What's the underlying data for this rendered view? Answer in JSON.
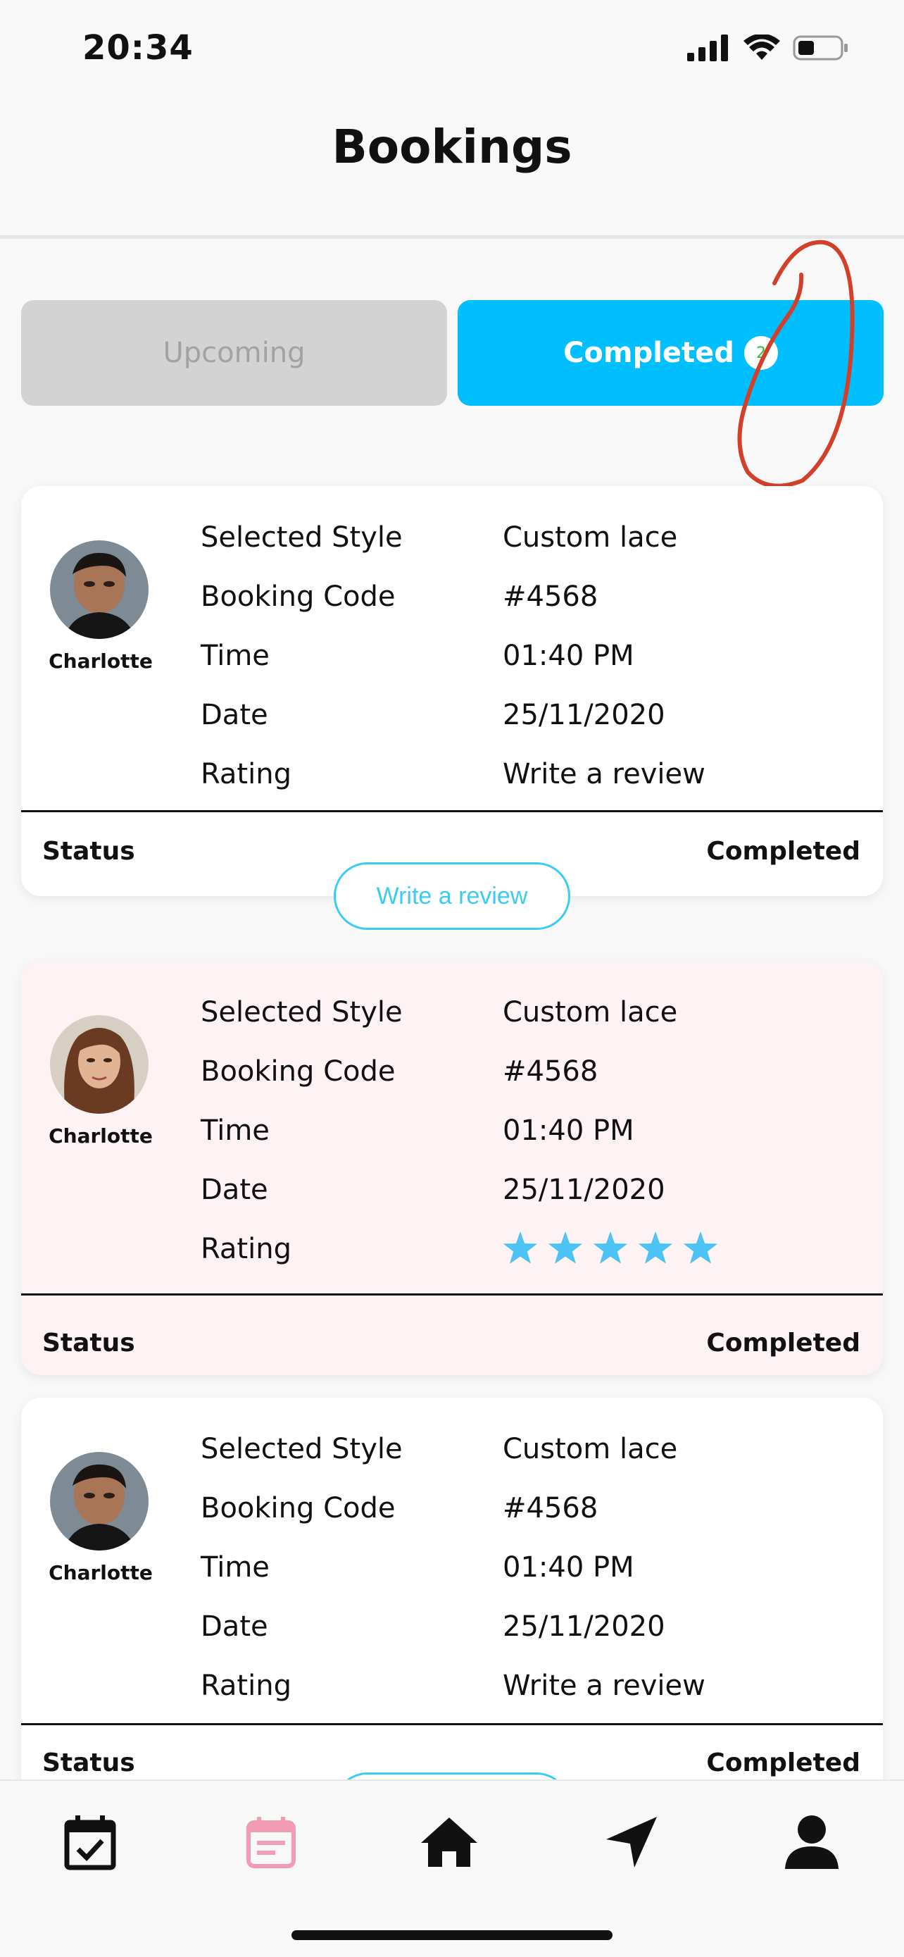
{
  "status_bar": {
    "time": "20:34"
  },
  "header": {
    "title": "Bookings"
  },
  "tabs": {
    "upcoming": "Upcoming",
    "completed": "Completed",
    "completed_count": "2"
  },
  "bookings": [
    {
      "stylist": "Charlotte",
      "labels": {
        "style": "Selected Style",
        "code": "Booking Code",
        "time": "Time",
        "date": "Date",
        "rating": "Rating"
      },
      "style": "Custom lace",
      "code": "#4568",
      "time": "01:40 PM",
      "date": "25/11/2020",
      "rating_text": "Write a review",
      "status_label": "Status",
      "status": "Completed",
      "review_button": "Write a review"
    },
    {
      "stylist": "Charlotte",
      "labels": {
        "style": "Selected Style",
        "code": "Booking Code",
        "time": "Time",
        "date": "Date",
        "rating": "Rating"
      },
      "style": "Custom lace",
      "code": "#4568",
      "time": "01:40 PM",
      "date": "25/11/2020",
      "rating_stars": 5,
      "status_label": "Status",
      "status": "Completed"
    },
    {
      "stylist": "Charlotte",
      "labels": {
        "style": "Selected Style",
        "code": "Booking Code",
        "time": "Time",
        "date": "Date",
        "rating": "Rating"
      },
      "style": "Custom lace",
      "code": "#4568",
      "time": "01:40 PM",
      "date": "25/11/2020",
      "rating_text": "Write a review",
      "status_label": "Status",
      "status": "Completed"
    }
  ],
  "tab_bar": {
    "items": [
      {
        "icon": "calendar-check-icon",
        "active": false
      },
      {
        "icon": "calendar-list-icon",
        "active": true
      },
      {
        "icon": "home-icon",
        "active": false
      },
      {
        "icon": "navigation-arrow-icon",
        "active": false
      },
      {
        "icon": "profile-icon",
        "active": false
      }
    ]
  },
  "colors": {
    "accent": "#00bfff",
    "review_outline": "#3ccbf2",
    "star": "#4cc2f5",
    "active_tab": "#f29bb4",
    "highlight_card": "#fdf2f4",
    "annotation": "#d2402a",
    "badge_text": "#2bbf3b"
  }
}
